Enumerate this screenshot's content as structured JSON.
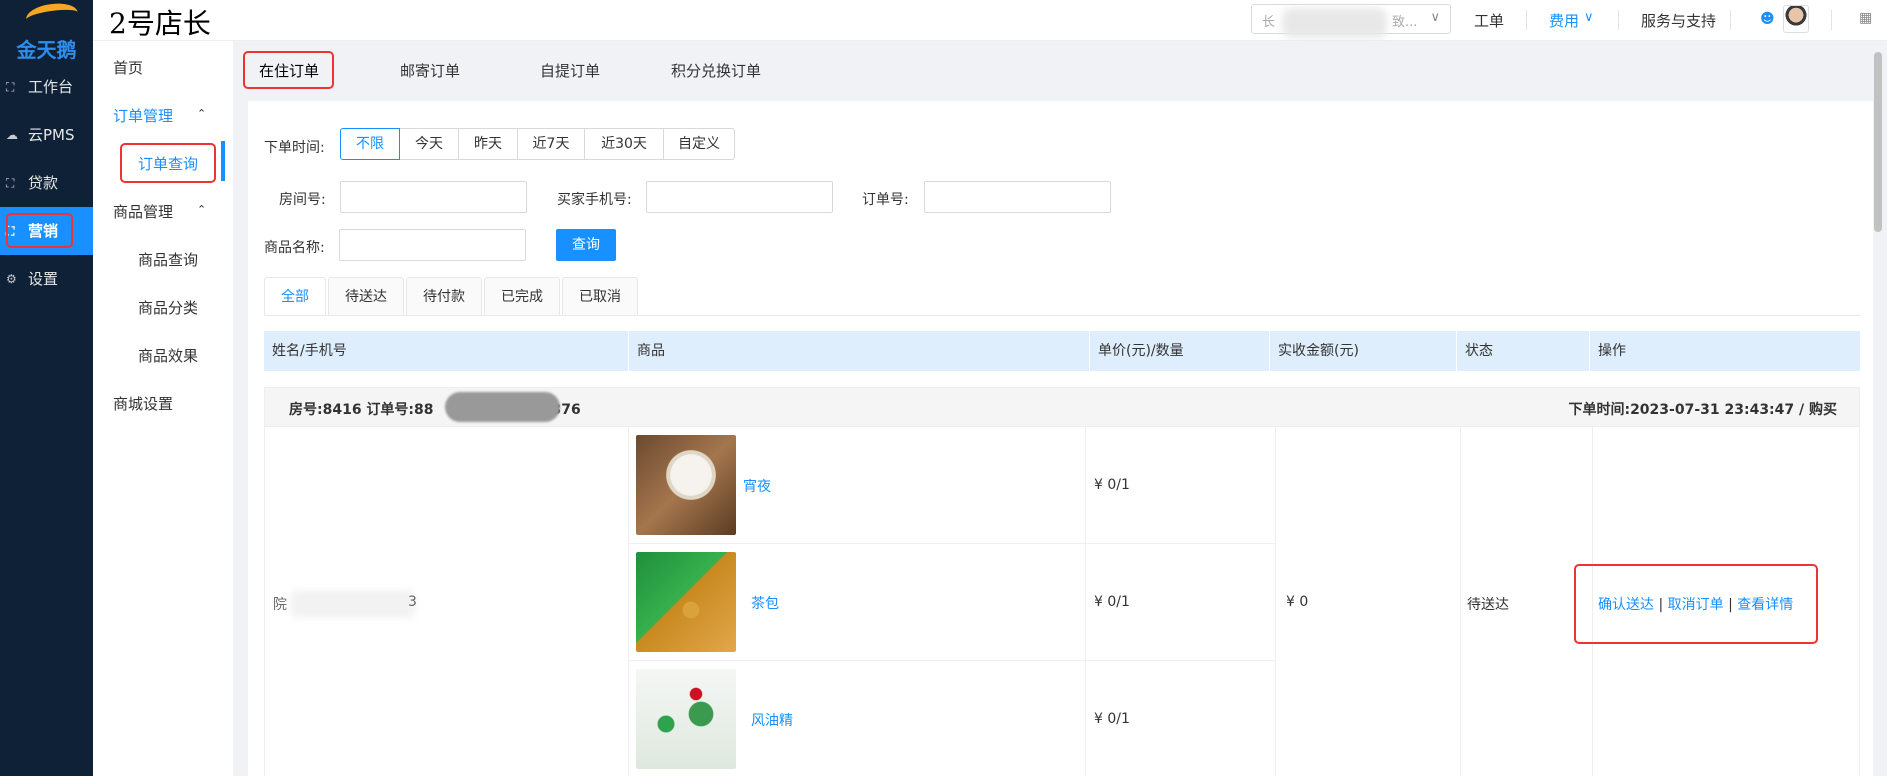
{
  "app": {
    "logo_text": "金天鹅",
    "brand": "2号店长"
  },
  "leftnav": [
    {
      "label": "工作台",
      "icon": "workbench-icon",
      "glyph": "⛶"
    },
    {
      "label": "云PMS",
      "icon": "cloud-icon",
      "glyph": "☁"
    },
    {
      "label": "贷款",
      "icon": "loan-icon",
      "glyph": "⛶"
    },
    {
      "label": "营销",
      "icon": "marketing-icon",
      "glyph": "⛶"
    },
    {
      "label": "设置",
      "icon": "gear-icon",
      "glyph": "⚙"
    }
  ],
  "topbar": {
    "select_prefix": "长",
    "select_suffix": "致...",
    "chevron": "∨",
    "links": {
      "ticket": "工单",
      "fees": "费用",
      "fees_chevron": "∨",
      "support": "服务与支持"
    },
    "user_icon": "user-icon",
    "grid_icon": "grid-icon"
  },
  "subnav": {
    "home": "首页",
    "order_mgmt": "订单管理",
    "order_query": "订单查询",
    "goods_mgmt": "商品管理",
    "goods_query": "商品查询",
    "goods_category": "商品分类",
    "goods_effect": "商品效果",
    "mall_settings": "商城设置",
    "caret_up": "⌃"
  },
  "page_tabs": [
    "在住订单",
    "邮寄订单",
    "自提订单",
    "积分兑换订单"
  ],
  "filters": {
    "order_time_label": "下单时间:",
    "time_options": [
      "不限",
      "今天",
      "昨天",
      "近7天",
      "近30天",
      "自定义"
    ],
    "room_label": "房间号:",
    "phone_label": "买家手机号:",
    "order_no_label": "订单号:",
    "goods_name_label": "商品名称:",
    "query_button": "查询"
  },
  "status_tabs": [
    "全部",
    "待送达",
    "待付款",
    "已完成",
    "已取消"
  ],
  "table": {
    "headers": [
      "姓名/手机号",
      "商品",
      "单价(元)/数量",
      "实收金额(元)",
      "状态",
      "操作"
    ]
  },
  "order": {
    "info_left_a": "房号:8416 订单号:88",
    "info_left_b": "376",
    "info_right": "下单时间:2023-07-31 23:43:47 / 购买",
    "name_prefix": "院",
    "name_suffix": "3",
    "items": [
      {
        "name": "宵夜",
        "price": "¥ 0/1"
      },
      {
        "name": "茶包",
        "price": "¥ 0/1"
      },
      {
        "name": "风油精",
        "price": "¥ 0/1"
      }
    ],
    "amount": "¥ 0",
    "status": "待送达",
    "actions": {
      "confirm": "确认送达",
      "cancel": "取消订单",
      "detail": "查看详情",
      "sep": "|"
    }
  }
}
